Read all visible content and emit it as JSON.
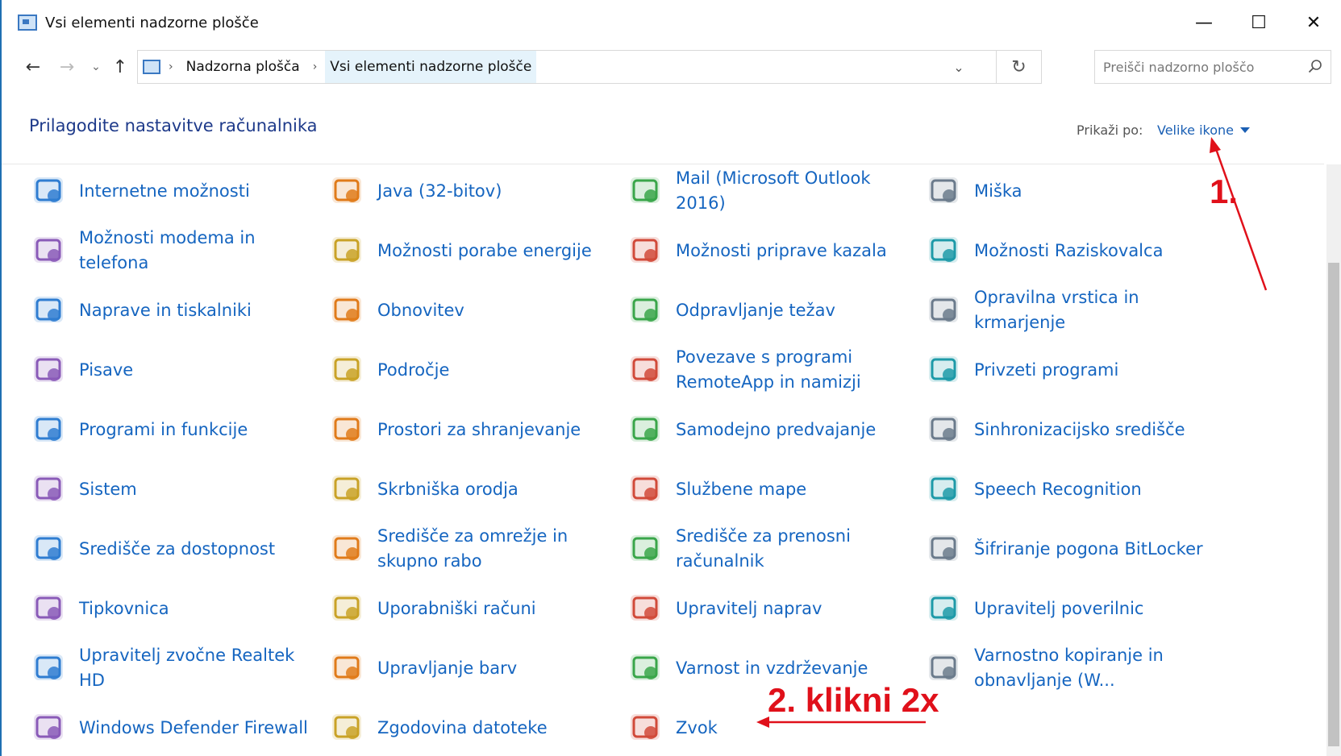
{
  "window": {
    "title": "Vsi elementi nadzorne plošče",
    "controls": {
      "minimize": "—",
      "maximize": "☐",
      "close": "✕"
    }
  },
  "nav": {
    "back": "←",
    "forward": "→",
    "recent": "⌄",
    "up": "↑",
    "breadcrumbs": [
      "Nadzorna plošča",
      "Vsi elementi nadzorne plošče"
    ],
    "separator": "›",
    "dropdown": "⌄",
    "refresh": "↻"
  },
  "search": {
    "placeholder": "Preišči nadzorno ploščo"
  },
  "header": {
    "title": "Prilagodite nastavitve računalnika",
    "view_by_label": "Prikaži po:",
    "view_by_value": "Velike ikone"
  },
  "items": [
    [
      "Internetne možnosti",
      "Java (32-bitov)",
      "Mail (Microsoft Outlook 2016)",
      "Miška"
    ],
    [
      "Možnosti modema in telefona",
      "Možnosti porabe energije",
      "Možnosti priprave kazala",
      "Možnosti Raziskovalca"
    ],
    [
      "Naprave in tiskalniki",
      "Obnovitev",
      "Odpravljanje težav",
      "Opravilna vrstica in krmarjenje"
    ],
    [
      "Pisave",
      "Področje",
      "Povezave s programi RemoteApp in namizji",
      "Privzeti programi"
    ],
    [
      "Programi in funkcije",
      "Prostori za shranjevanje",
      "Samodejno predvajanje",
      "Sinhronizacijsko središče"
    ],
    [
      "Sistem",
      "Skrbniška orodja",
      "Službene mape",
      "Speech Recognition"
    ],
    [
      "Središče za dostopnost",
      "Središče za omrežje in skupno rabo",
      "Središče za prenosni računalnik",
      "Šifriranje pogona BitLocker"
    ],
    [
      "Tipkovnica",
      "Uporabniški računi",
      "Upravitelj naprav",
      "Upravitelj poverilnic"
    ],
    [
      "Upravitelj zvočne Realtek HD",
      "Upravljanje barv",
      "Varnost in vzdrževanje",
      "Varnostno kopiranje in obnavljanje (W..."
    ],
    [
      "Windows Defender Firewall",
      "Zgodovina datoteke",
      "Zvok"
    ]
  ],
  "icons": [
    [
      "globe-check-icon",
      "java-cup-icon",
      "mail-icon",
      "mouse-icon"
    ],
    [
      "phone-modem-icon",
      "battery-plug-icon",
      "indexing-magnifier-icon",
      "folder-options-icon"
    ],
    [
      "printer-icon",
      "recovery-icon",
      "troubleshoot-icon",
      "taskbar-icon"
    ],
    [
      "fonts-icon",
      "region-globe-clock-icon",
      "remoteapp-icon",
      "default-programs-icon"
    ],
    [
      "programs-box-icon",
      "storage-disks-icon",
      "autoplay-icon",
      "sync-center-icon"
    ],
    [
      "system-monitor-icon",
      "admin-tools-icon",
      "work-folders-icon",
      "microphone-icon"
    ],
    [
      "accessibility-icon",
      "network-icon",
      "mobility-center-icon",
      "bitlocker-key-icon"
    ],
    [
      "keyboard-icon",
      "users-icon",
      "device-manager-icon",
      "credential-safe-icon"
    ],
    [
      "speaker-icon",
      "color-management-icon",
      "security-flag-icon",
      "backup-restore-icon"
    ],
    [
      "firewall-icon",
      "file-history-icon",
      "sound-speaker-icon"
    ]
  ],
  "annotations": {
    "step1": "1.",
    "step2": "2. klikni 2x",
    "color": "#e0101a"
  },
  "colors": {
    "link": "#1565c0",
    "title": "#1e3a8a",
    "accent": "#1a5fb4"
  }
}
